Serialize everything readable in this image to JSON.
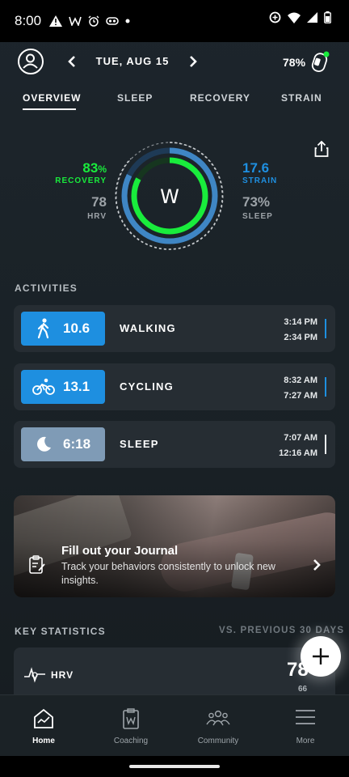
{
  "status_bar": {
    "time": "8:00",
    "left_icons": [
      "warning-icon",
      "whoop-w-icon",
      "alarm-icon",
      "link-icon",
      "dot-icon"
    ],
    "right_icons": [
      "data-saver-icon",
      "wifi-icon",
      "signal-icon",
      "battery-icon"
    ]
  },
  "header": {
    "date": "TUE, AUG 15",
    "band_battery": "78%"
  },
  "tabs": [
    {
      "label": "OVERVIEW",
      "active": true
    },
    {
      "label": "SLEEP",
      "active": false
    },
    {
      "label": "RECOVERY",
      "active": false
    },
    {
      "label": "STRAIN",
      "active": false
    }
  ],
  "overview": {
    "recovery": {
      "value": "83",
      "unit": "%",
      "label": "RECOVERY",
      "color": "#19ec3c"
    },
    "hrv": {
      "value": "78",
      "label": "HRV"
    },
    "strain": {
      "value": "17.6",
      "label": "STRAIN",
      "color": "#1e8fe0"
    },
    "sleep": {
      "value": "73%",
      "label": "SLEEP"
    },
    "ring_logo": "W"
  },
  "activities": {
    "title": "ACTIVITIES",
    "items": [
      {
        "value": "10.6",
        "name": "WALKING",
        "end": "3:14 PM",
        "start": "2:34 PM",
        "icon": "walking-icon",
        "color": "#1e8fe0"
      },
      {
        "value": "13.1",
        "name": "CYCLING",
        "end": "8:32 AM",
        "start": "7:27 AM",
        "icon": "cycling-icon",
        "color": "#1e8fe0"
      },
      {
        "value": "6:18",
        "name": "SLEEP",
        "end": "7:07 AM",
        "start": "12:16 AM",
        "icon": "moon-icon",
        "color": "#7f9bb6"
      }
    ]
  },
  "journal": {
    "title": "Fill out your Journal",
    "subtitle": "Track your behaviors consistently to unlock new insights."
  },
  "key_statistics": {
    "title": "KEY STATISTICS",
    "comparison": "VS. PREVIOUS 30 DAYS",
    "hrv": {
      "label": "HRV",
      "value": "78",
      "previous": "66"
    }
  },
  "nav": [
    {
      "label": "Home",
      "icon": "home-icon",
      "active": true
    },
    {
      "label": "Coaching",
      "icon": "coaching-icon",
      "active": false
    },
    {
      "label": "Community",
      "icon": "community-icon",
      "active": false
    },
    {
      "label": "More",
      "icon": "menu-icon",
      "active": false
    }
  ]
}
